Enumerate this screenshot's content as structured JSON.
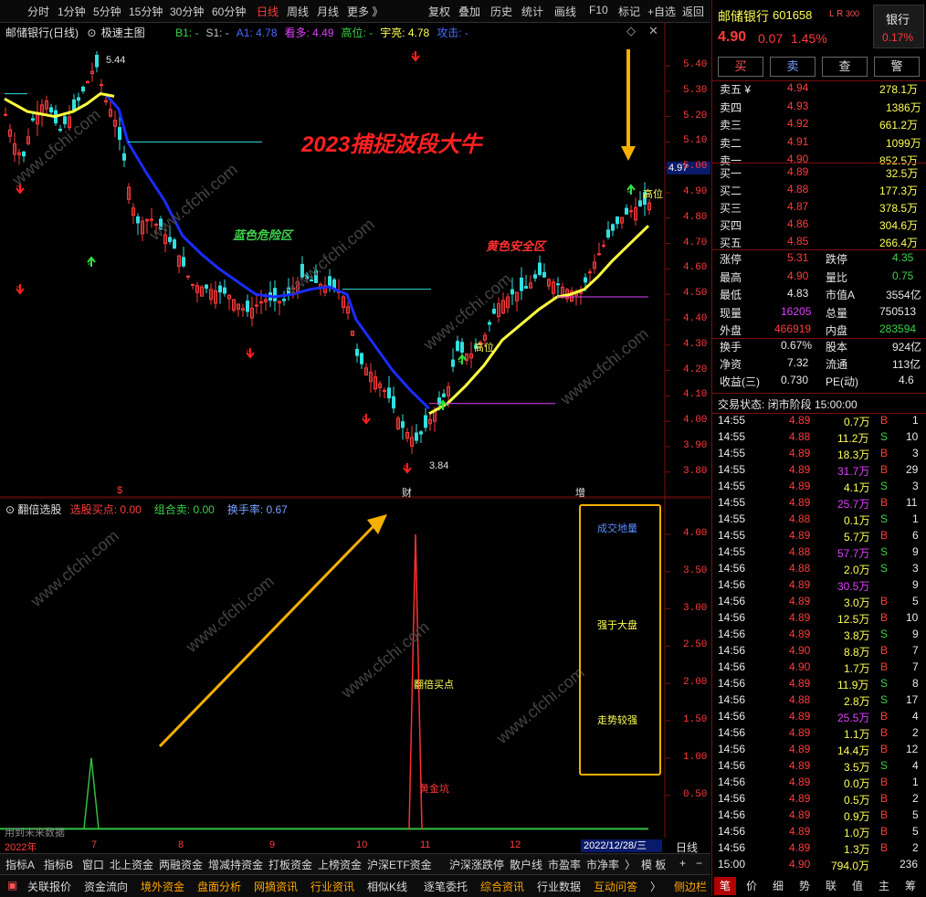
{
  "toolbar": {
    "periods": [
      "分时",
      "1分钟",
      "5分钟",
      "15分钟",
      "30分钟",
      "60分钟",
      "日线",
      "周线",
      "月线",
      "更多 》"
    ],
    "active_period": "日线",
    "right_tools": [
      "复权",
      "叠加",
      "历史",
      "统计",
      "画线",
      "F10",
      "标记",
      "+自选",
      "返回"
    ]
  },
  "main_chart": {
    "title": "邮储银行(日线)",
    "indicator_name": "极速主图",
    "legend": [
      {
        "label": "B1: -",
        "color": "#3cd24a"
      },
      {
        "label": "S1: -",
        "color": "#c0c0c0"
      },
      {
        "label": "A1: 4.78",
        "color": "#4a6cff"
      },
      {
        "label": "看多: 4.49",
        "color": "#e040ff"
      },
      {
        "label": "高位: -",
        "color": "#3cd24a"
      },
      {
        "label": "宇亮: 4.78",
        "color": "#ffff55"
      },
      {
        "label": "攻击: -",
        "color": "#4a6cff"
      }
    ],
    "y_ticks": [
      "5.40",
      "5.30",
      "5.20",
      "5.10",
      "5.00",
      "4.90",
      "4.80",
      "4.70",
      "4.60",
      "4.50",
      "4.40",
      "4.30",
      "4.20",
      "4.10",
      "4.00",
      "3.90",
      "3.80"
    ],
    "current_price_tag": "4.97",
    "high_label": "5.44",
    "low_label": "3.84",
    "headline": "2023捕捉波段大牛",
    "zone_blue": "蓝色危险区",
    "zone_yellow": "黄色安全区",
    "gaowei1": "高位",
    "gaowei2": "高位",
    "markers": [
      "$",
      "财",
      "增"
    ]
  },
  "sub_chart": {
    "name": "翻倍选股",
    "legend": [
      {
        "label": "选股买点: 0.00",
        "color": "#ff3b3b"
      },
      {
        "label": "组合卖: 0.00",
        "color": "#3cd24a"
      },
      {
        "label": "换手率: 0.67",
        "color": "#7aa0ff"
      }
    ],
    "y_ticks": [
      "4.00",
      "3.50",
      "3.00",
      "2.50",
      "2.00",
      "1.50",
      "1.00",
      "0.50"
    ],
    "buy_label": "翻倍买点",
    "pit_label": "黄金坑",
    "box_items": [
      "成交地量",
      "强于大盘",
      "走势较强"
    ],
    "future_note": "用到未来数据",
    "x_labels": [
      "2022年",
      "7",
      "8",
      "9",
      "10",
      "11",
      "12"
    ],
    "date_tag": "2022/12/28/三",
    "period_tag": "日线"
  },
  "bottom_bar1": [
    "指标A",
    "指标B",
    "窗口",
    "北上资金",
    "两融资金",
    "增减持资金",
    "打板资金",
    "上榜资金",
    "沪深ETF资金",
    "沪深涨跌停",
    "散户线",
    "市盈率",
    "市净率",
    "〉",
    "模 板",
    "+",
    "−"
  ],
  "bottom_bar2": [
    {
      "label": "关联报价",
      "orange": false
    },
    {
      "label": "资金流向",
      "orange": false
    },
    {
      "label": "境外资金",
      "orange": true
    },
    {
      "label": "盘面分析",
      "orange": true
    },
    {
      "label": "网摘资讯",
      "orange": true
    },
    {
      "label": "行业资讯",
      "orange": true
    },
    {
      "label": "相似K线",
      "orange": false
    },
    {
      "label": "逐笔委托",
      "orange": false
    },
    {
      "label": "综合资讯",
      "orange": true
    },
    {
      "label": "行业数据",
      "orange": false
    },
    {
      "label": "互动问答",
      "orange": true
    },
    {
      "label": "〉",
      "orange": false
    },
    {
      "label": "侧边栏",
      "orange": true
    }
  ],
  "quote": {
    "name": "邮储银行",
    "code": "601658",
    "flags": "L R",
    "flag_num": "300",
    "sector": "银行",
    "sector_pct": "0.17%",
    "price": "4.90",
    "change": "0.07",
    "change_pct": "1.45%",
    "buttons": [
      "买",
      "卖",
      "查",
      "警"
    ],
    "asks": [
      {
        "label": "卖五 ¥",
        "price": "4.94",
        "vol": "278.1万"
      },
      {
        "label": "卖四",
        "price": "4.93",
        "vol": "1386万"
      },
      {
        "label": "卖三",
        "price": "4.92",
        "vol": "661.2万"
      },
      {
        "label": "卖二",
        "price": "4.91",
        "vol": "1099万"
      },
      {
        "label": "卖一",
        "price": "4.90",
        "vol": "852.5万"
      }
    ],
    "bids": [
      {
        "label": "买一",
        "price": "4.89",
        "vol": "32.5万"
      },
      {
        "label": "买二",
        "price": "4.88",
        "vol": "177.3万"
      },
      {
        "label": "买三",
        "price": "4.87",
        "vol": "378.5万"
      },
      {
        "label": "买四",
        "price": "4.86",
        "vol": "304.6万"
      },
      {
        "label": "买五",
        "price": "4.85",
        "vol": "266.4万"
      }
    ],
    "stats": [
      {
        "l1": "涨停",
        "v1": "5.31",
        "c1": "red",
        "l2": "跌停",
        "v2": "4.35",
        "c2": "green"
      },
      {
        "l1": "最高",
        "v1": "4.90",
        "c1": "red",
        "l2": "量比",
        "v2": "0.75",
        "c2": "green"
      },
      {
        "l1": "最低",
        "v1": "4.83",
        "c1": "white",
        "l2": "市值A",
        "v2": "3554亿",
        "c2": "white"
      },
      {
        "l1": "现量",
        "v1": "16205",
        "c1": "mag",
        "l2": "总量",
        "v2": "750513",
        "c2": "white"
      },
      {
        "l1": "外盘",
        "v1": "466919",
        "c1": "red",
        "l2": "内盘",
        "v2": "283594",
        "c2": "green"
      }
    ],
    "stats2": [
      {
        "l1": "换手",
        "v1": "0.67%",
        "l2": "股本",
        "v2": "924亿"
      },
      {
        "l1": "净资",
        "v1": "7.32",
        "l2": "流通",
        "v2": "113亿"
      },
      {
        "l1": "收益(三)",
        "v1": "0.730",
        "l2": "PE(动)",
        "v2": "4.6"
      }
    ],
    "trade_status": "交易状态: 闭市阶段 15:00:00",
    "ticks": [
      {
        "t": "14:55",
        "p": "4.89",
        "pc": "red",
        "v": "0.7万",
        "vc": "yellow",
        "d": "B",
        "n": "1"
      },
      {
        "t": "14:55",
        "p": "4.88",
        "pc": "red",
        "v": "11.2万",
        "vc": "yellow",
        "d": "S",
        "n": "10"
      },
      {
        "t": "14:55",
        "p": "4.89",
        "pc": "red",
        "v": "18.3万",
        "vc": "yellow",
        "d": "B",
        "n": "3"
      },
      {
        "t": "14:55",
        "p": "4.89",
        "pc": "red",
        "v": "31.7万",
        "vc": "mag",
        "d": "B",
        "n": "29"
      },
      {
        "t": "14:55",
        "p": "4.89",
        "pc": "red",
        "v": "4.1万",
        "vc": "yellow",
        "d": "S",
        "n": "3"
      },
      {
        "t": "14:55",
        "p": "4.89",
        "pc": "red",
        "v": "25.7万",
        "vc": "mag",
        "d": "B",
        "n": "11"
      },
      {
        "t": "14:55",
        "p": "4.88",
        "pc": "red",
        "v": "0.1万",
        "vc": "yellow",
        "d": "S",
        "n": "1"
      },
      {
        "t": "14:55",
        "p": "4.89",
        "pc": "red",
        "v": "5.7万",
        "vc": "yellow",
        "d": "B",
        "n": "6"
      },
      {
        "t": "14:55",
        "p": "4.88",
        "pc": "red",
        "v": "57.7万",
        "vc": "mag",
        "d": "S",
        "n": "9"
      },
      {
        "t": "14:56",
        "p": "4.88",
        "pc": "red",
        "v": "2.0万",
        "vc": "yellow",
        "d": "S",
        "n": "3"
      },
      {
        "t": "14:56",
        "p": "4.89",
        "pc": "red",
        "v": "30.5万",
        "vc": "mag",
        "d": "",
        "n": "9"
      },
      {
        "t": "14:56",
        "p": "4.89",
        "pc": "red",
        "v": "3.0万",
        "vc": "yellow",
        "d": "B",
        "n": "5"
      },
      {
        "t": "14:56",
        "p": "4.89",
        "pc": "red",
        "v": "12.5万",
        "vc": "yellow",
        "d": "B",
        "n": "10"
      },
      {
        "t": "14:56",
        "p": "4.89",
        "pc": "red",
        "v": "3.8万",
        "vc": "yellow",
        "d": "S",
        "n": "9"
      },
      {
        "t": "14:56",
        "p": "4.90",
        "pc": "red",
        "v": "8.8万",
        "vc": "yellow",
        "d": "B",
        "n": "7"
      },
      {
        "t": "14:56",
        "p": "4.90",
        "pc": "red",
        "v": "1.7万",
        "vc": "yellow",
        "d": "B",
        "n": "7"
      },
      {
        "t": "14:56",
        "p": "4.89",
        "pc": "red",
        "v": "11.9万",
        "vc": "yellow",
        "d": "S",
        "n": "8"
      },
      {
        "t": "14:56",
        "p": "4.88",
        "pc": "red",
        "v": "2.8万",
        "vc": "yellow",
        "d": "S",
        "n": "17"
      },
      {
        "t": "14:56",
        "p": "4.89",
        "pc": "red",
        "v": "25.5万",
        "vc": "mag",
        "d": "B",
        "n": "4"
      },
      {
        "t": "14:56",
        "p": "4.89",
        "pc": "red",
        "v": "1.1万",
        "vc": "yellow",
        "d": "B",
        "n": "2"
      },
      {
        "t": "14:56",
        "p": "4.89",
        "pc": "red",
        "v": "14.4万",
        "vc": "yellow",
        "d": "B",
        "n": "12"
      },
      {
        "t": "14:56",
        "p": "4.89",
        "pc": "red",
        "v": "3.5万",
        "vc": "yellow",
        "d": "S",
        "n": "4"
      },
      {
        "t": "14:56",
        "p": "4.89",
        "pc": "red",
        "v": "0.0万",
        "vc": "yellow",
        "d": "B",
        "n": "1"
      },
      {
        "t": "14:56",
        "p": "4.89",
        "pc": "red",
        "v": "0.5万",
        "vc": "yellow",
        "d": "B",
        "n": "2"
      },
      {
        "t": "14:56",
        "p": "4.89",
        "pc": "red",
        "v": "0.9万",
        "vc": "yellow",
        "d": "B",
        "n": "5"
      },
      {
        "t": "14:56",
        "p": "4.89",
        "pc": "red",
        "v": "1.0万",
        "vc": "yellow",
        "d": "B",
        "n": "5"
      },
      {
        "t": "14:56",
        "p": "4.89",
        "pc": "red",
        "v": "1.3万",
        "vc": "yellow",
        "d": "B",
        "n": "2"
      },
      {
        "t": "15:00",
        "p": "4.90",
        "pc": "red",
        "v": "794.0万",
        "vc": "yellow",
        "d": "",
        "n": "236"
      }
    ],
    "tabs": [
      "笔",
      "价",
      "细",
      "势",
      "联",
      "值",
      "主",
      "筹"
    ]
  },
  "watermark": "www.cfchi.com"
}
